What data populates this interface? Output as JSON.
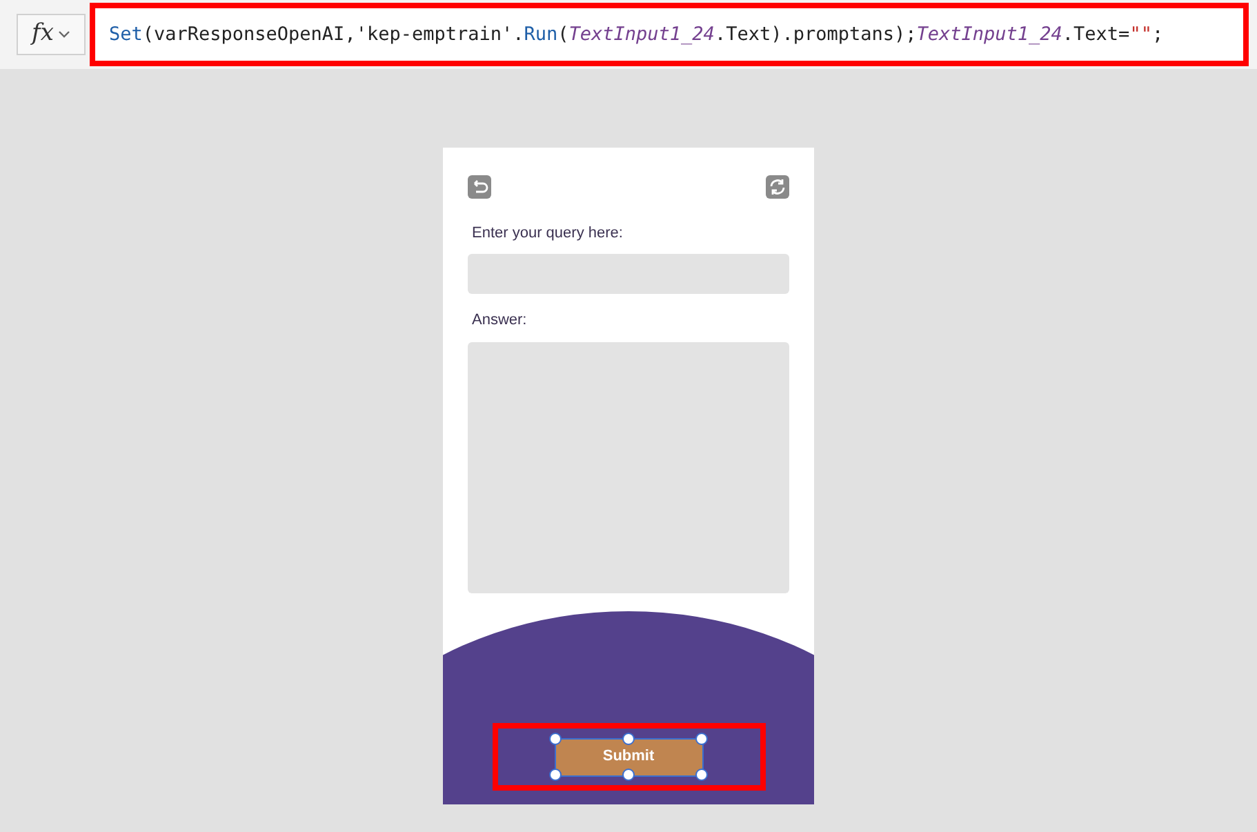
{
  "formula_bar": {
    "fx_label": "fx",
    "tokens": [
      {
        "kind": "function",
        "text": "Set"
      },
      {
        "kind": "plain",
        "text": "(varResponseOpenAI,'kep-emptrain'."
      },
      {
        "kind": "function",
        "text": "Run"
      },
      {
        "kind": "plain",
        "text": "("
      },
      {
        "kind": "param",
        "text": "TextInput1_24"
      },
      {
        "kind": "plain",
        "text": ".Text).promptans);"
      },
      {
        "kind": "param",
        "text": "TextInput1_24"
      },
      {
        "kind": "plain",
        "text": ".Text="
      },
      {
        "kind": "string",
        "text": "\"\""
      },
      {
        "kind": "plain",
        "text": ";"
      }
    ]
  },
  "app": {
    "query_label": "Enter your query here:",
    "answer_label": "Answer:",
    "submit": {
      "label": "Submit",
      "selected": true
    }
  }
}
